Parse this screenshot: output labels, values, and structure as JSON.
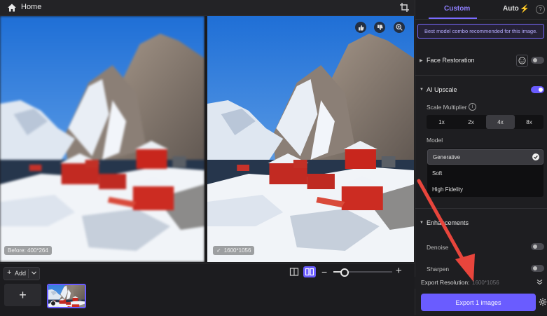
{
  "topbar": {
    "home_label": "Home"
  },
  "viewer": {
    "before_caption": "Before: 400*264",
    "after_caption": "1600*1056"
  },
  "bottom": {
    "add_label": "Add",
    "add_plus": "+",
    "zoom_minus": "−",
    "zoom_plus": "+",
    "new_image_plus": "+",
    "zoom_level": 0.18
  },
  "panel": {
    "tabs": [
      {
        "label": "Custom",
        "active": true
      },
      {
        "label": "Auto",
        "active": false
      }
    ],
    "help": "?",
    "tip": "Best model combo recommended for this image.",
    "face_restoration": {
      "label": "Face Restoration",
      "enabled": false
    },
    "ai_upscale": {
      "label": "AI Upscale",
      "enabled": true
    },
    "scale_multiplier": {
      "label": "Scale Multiplier",
      "options": [
        "1x",
        "2x",
        "4x",
        "8x"
      ],
      "selected": "4x"
    },
    "model": {
      "label": "Model",
      "options": [
        "Generative",
        "Soft",
        "High Fidelity"
      ],
      "selected": "Generative"
    },
    "enhancements": {
      "label": "Enhancements",
      "denoise": {
        "label": "Denoise",
        "enabled": false
      },
      "sharpen": {
        "label": "Sharpen",
        "enabled": false
      }
    },
    "export_resolution": {
      "label": "Export Resolution:",
      "value": "1600*1056"
    },
    "export_button": "Export 1 images"
  },
  "colors": {
    "accent": "#6a5cff",
    "accent_text": "#8f80ff",
    "arrow": "#e8453c"
  }
}
